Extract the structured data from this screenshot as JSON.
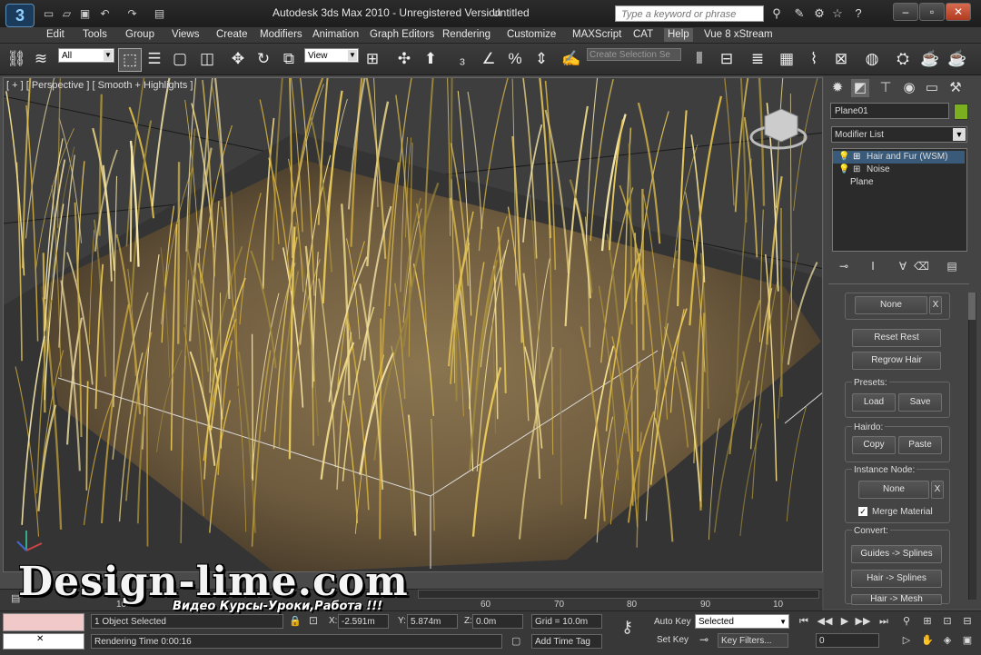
{
  "titlebar": {
    "app_title": "Autodesk 3ds Max  2010   - Unregistered Version",
    "document": "Untitled",
    "search_placeholder": "Type a keyword or phrase"
  },
  "menu": [
    "Edit",
    "Tools",
    "Group",
    "Views",
    "Create",
    "Modifiers",
    "Animation",
    "Graph Editors",
    "Rendering",
    "Customize",
    "MAXScript",
    "CAT",
    "Help",
    "Vue 8 xStream"
  ],
  "toolbar": {
    "selection_filter": "All",
    "ref_coord": "View",
    "selection_set_placeholder": "Create Selection Se"
  },
  "viewport": {
    "label": "[ + ] [ Perspective ] [ Smooth + Highlights ]"
  },
  "command_panel": {
    "object_name": "Plane01",
    "object_color": "#7ab020",
    "modifier_list": "Modifier List",
    "stack": [
      "Hair and Fur (WSM)",
      "Noise",
      "Plane"
    ],
    "none_top": "None",
    "x_top": "X",
    "reset_rest": "Reset Rest",
    "regrow_hair": "Regrow Hair",
    "presets_label": "Presets:",
    "load": "Load",
    "save": "Save",
    "hairdo_label": "Hairdo:",
    "copy": "Copy",
    "paste": "Paste",
    "instance_label": "Instance Node:",
    "instance_none": "None",
    "instance_x": "X",
    "merge_material": "Merge Material",
    "convert_label": "Convert:",
    "guides_splines": "Guides -> Splines",
    "hair_splines": "Hair -> Splines",
    "hair_mesh": "Hair -> Mesh"
  },
  "timeline": {
    "ticks": [
      "10",
      "60",
      "70",
      "80",
      "90",
      "10"
    ]
  },
  "status": {
    "selected": "1 Object Selected",
    "rendering_time": "Rendering Time  0:00:16",
    "x_label": "X:",
    "x_value": "-2.591m",
    "y_label": "Y:",
    "y_value": "5.874m",
    "z_label": "Z:",
    "z_value": "0.0m",
    "grid": "Grid = 10.0m",
    "add_time_tag": "Add Time Tag",
    "auto_key": "Auto Key",
    "set_key": "Set Key",
    "key_mode": "Selected",
    "key_filters": "Key Filters...",
    "frame": "0"
  },
  "watermark": {
    "brand": "Design-lime.com",
    "subtitle": "Видео Курсы-Уроки,Работа !!!"
  }
}
